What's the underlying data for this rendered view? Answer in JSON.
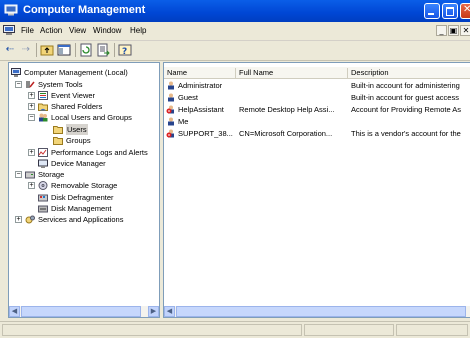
{
  "window": {
    "title": "Computer Management",
    "title_bar_color": "#0054e3"
  },
  "menu": [
    "File",
    "Action",
    "View",
    "Window",
    "Help"
  ],
  "tree": {
    "root": "Computer Management (Local)",
    "items": [
      {
        "label": "System Tools",
        "icon": "system-tools-icon"
      },
      {
        "label": "Event Viewer",
        "icon": "event-viewer-icon"
      },
      {
        "label": "Shared Folders",
        "icon": "shared-folders-icon"
      },
      {
        "label": "Local Users and Groups",
        "icon": "users-groups-icon"
      },
      {
        "label": "Users",
        "icon": "folder-icon",
        "selected": true
      },
      {
        "label": "Groups",
        "icon": "folder-icon"
      },
      {
        "label": "Performance Logs and Alerts",
        "icon": "perf-logs-icon"
      },
      {
        "label": "Device Manager",
        "icon": "device-manager-icon"
      },
      {
        "label": "Storage",
        "icon": "storage-icon"
      },
      {
        "label": "Removable Storage",
        "icon": "removable-storage-icon"
      },
      {
        "label": "Disk Defragmenter",
        "icon": "defrag-icon"
      },
      {
        "label": "Disk Management",
        "icon": "disk-management-icon"
      },
      {
        "label": "Services and Applications",
        "icon": "services-icon"
      }
    ]
  },
  "list": {
    "columns": [
      "Name",
      "Full Name",
      "Description"
    ],
    "rows": [
      {
        "name": "Administrator",
        "full_name": "",
        "description": "Built-in account for administering",
        "disabled": false
      },
      {
        "name": "Guest",
        "full_name": "",
        "description": "Built-in account for guest access",
        "disabled": false
      },
      {
        "name": "HelpAssistant",
        "full_name": "Remote Desktop Help Assi...",
        "description": "Account for Providing Remote As",
        "disabled": true
      },
      {
        "name": "Me",
        "full_name": "",
        "description": "",
        "disabled": false
      },
      {
        "name": "SUPPORT_38...",
        "full_name": "CN=Microsoft Corporation...",
        "description": "This is a vendor's account for the",
        "disabled": true
      }
    ]
  }
}
